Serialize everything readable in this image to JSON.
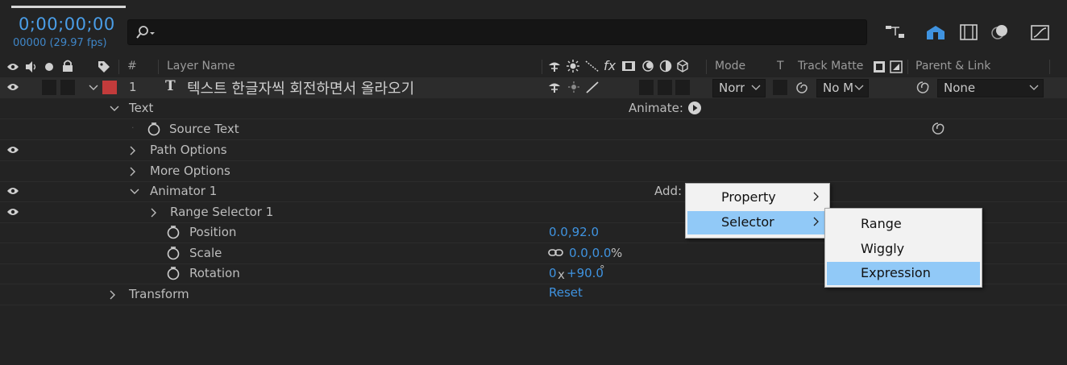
{
  "header": {
    "timecode": "0;00;00;00",
    "fps": "00000 (29.97 fps)",
    "search_icon": "search-icon"
  },
  "columns": {
    "hash": "#",
    "layer_name": "Layer Name",
    "mode": "Mode",
    "t": "T",
    "track_matte": "Track Matte",
    "parent_link": "Parent & Link"
  },
  "layer": {
    "number": "1",
    "name": "텍스트 한글자씩 회전하면서 올라오기",
    "label_color": "#c23b3b",
    "mode": "Norr",
    "track_matte": "No M",
    "parent": "None"
  },
  "tree": {
    "text": "Text",
    "animate": "Animate:",
    "source_text": "Source Text",
    "path_options": "Path Options",
    "more_options": "More Options",
    "animator": "Animator 1",
    "add": "Add:",
    "range_selector": "Range Selector 1",
    "position": "Position",
    "position_value": "0.0,92.0",
    "scale": "Scale",
    "scale_value": "0.0,0.0",
    "scale_unit": "%",
    "rotation": "Rotation",
    "rotation_rev": "0",
    "rotation_x": "x",
    "rotation_deg": "+90.0",
    "rotation_unit": "°",
    "transform": "Transform",
    "reset": "Reset"
  },
  "menu": {
    "items": [
      "Property",
      "Selector"
    ],
    "highlighted": "Selector"
  },
  "submenu": {
    "items": [
      "Range",
      "Wiggly",
      "Expression"
    ],
    "highlighted": "Expression"
  },
  "colors": {
    "accent": "#3f93e0",
    "highlight": "#91c9f7"
  }
}
